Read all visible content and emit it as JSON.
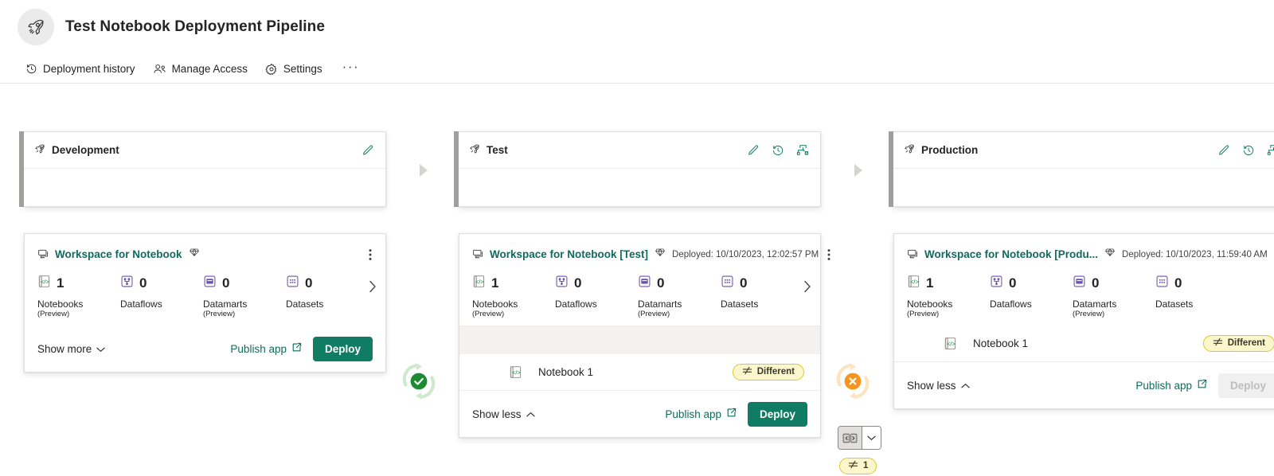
{
  "header": {
    "title": "Test Notebook Deployment Pipeline",
    "rocket_icon": "rocket-icon",
    "commands": [
      {
        "label": "Deployment history",
        "icon": "history-icon"
      },
      {
        "label": "Manage Access",
        "icon": "people-icon"
      },
      {
        "label": "Settings",
        "icon": "gear-icon"
      }
    ],
    "overflow_label": "···"
  },
  "colors": {
    "accent_green": "#107c63",
    "link_green": "#0f6b5b",
    "stage_accent": "#a19f9d",
    "badge_bg": "#fbf6cb",
    "badge_border": "#dfc72a",
    "band_grey": "#f3f2f1",
    "status_ok": "#2f8f3e",
    "status_warn": "#f7941d"
  },
  "stages": [
    {
      "name": "Development",
      "actions": [
        "edit-icon"
      ],
      "workspace": {
        "name": "Workspace for Notebook",
        "premium_icon": "premium-diamond-icon",
        "deployed": "",
        "stats": [
          {
            "label": "Notebooks",
            "sub": "(Preview)",
            "count": "1",
            "icon": "notebook-icon"
          },
          {
            "label": "Dataflows",
            "sub": "",
            "count": "0",
            "icon": "dataflow-icon"
          },
          {
            "label": "Datamarts",
            "sub": "(Preview)",
            "count": "0",
            "icon": "datamart-icon"
          },
          {
            "label": "Datasets",
            "sub": "",
            "count": "0",
            "icon": "dataset-icon"
          }
        ],
        "expanded": false,
        "show_toggle_label": "Show more",
        "publish_label": "Publish app",
        "deploy_label": "Deploy",
        "deploy_disabled": false,
        "items": []
      }
    },
    {
      "name": "Test",
      "actions": [
        "edit-icon",
        "history-icon",
        "deployment-rules-icon"
      ],
      "workspace": {
        "name": "Workspace for Notebook [Test]",
        "premium_icon": "premium-diamond-icon",
        "deployed": "Deployed: 10/10/2023, 12:02:57 PM",
        "stats": [
          {
            "label": "Notebooks",
            "sub": "(Preview)",
            "count": "1",
            "icon": "notebook-icon"
          },
          {
            "label": "Dataflows",
            "sub": "",
            "count": "0",
            "icon": "dataflow-icon"
          },
          {
            "label": "Datamarts",
            "sub": "(Preview)",
            "count": "0",
            "icon": "datamart-icon"
          },
          {
            "label": "Datasets",
            "sub": "",
            "count": "0",
            "icon": "dataset-icon"
          }
        ],
        "expanded": true,
        "show_toggle_label": "Show less",
        "publish_label": "Publish app",
        "deploy_label": "Deploy",
        "deploy_disabled": false,
        "items": [
          {
            "name": "Notebook 1",
            "icon": "notebook-icon",
            "status": "Different"
          }
        ]
      }
    },
    {
      "name": "Production",
      "actions": [
        "edit-icon",
        "history-icon",
        "deployment-rules-icon"
      ],
      "workspace": {
        "name": "Workspace for Notebook [Produ...",
        "premium_icon": "premium-diamond-icon",
        "deployed": "Deployed: 10/10/2023, 11:59:40 AM",
        "stats": [
          {
            "label": "Notebooks",
            "sub": "(Preview)",
            "count": "1",
            "icon": "notebook-icon"
          },
          {
            "label": "Dataflows",
            "sub": "",
            "count": "0",
            "icon": "dataflow-icon"
          },
          {
            "label": "Datamarts",
            "sub": "(Preview)",
            "count": "0",
            "icon": "datamart-icon"
          },
          {
            "label": "Datasets",
            "sub": "",
            "count": "0",
            "icon": "dataset-icon"
          }
        ],
        "expanded": true,
        "show_toggle_label": "Show less",
        "publish_label": "Publish app",
        "deploy_label": "Deploy",
        "deploy_disabled": true,
        "items": [
          {
            "name": "Notebook 1",
            "icon": "notebook-icon",
            "status": "Different"
          }
        ]
      }
    }
  ],
  "comparisons": [
    {
      "between": "Development-Test",
      "state": "same",
      "icon": "compare-success-icon"
    },
    {
      "between": "Test-Production",
      "state": "different",
      "icon": "compare-warning-icon",
      "toggle_icon": "split-view-icon",
      "caret_icon": "chevron-down-icon",
      "diff_count": "1",
      "diff_icon": "not-equal-icon"
    }
  ]
}
